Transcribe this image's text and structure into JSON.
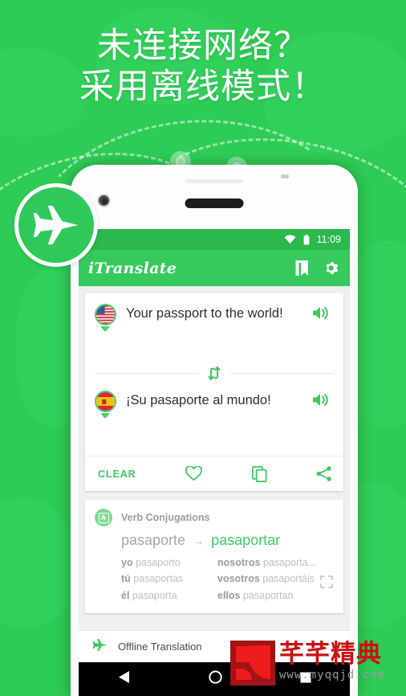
{
  "headline": {
    "line1": "未连接网络？",
    "line2": "采用离线模式！"
  },
  "badge": {
    "icon": "airplane-icon"
  },
  "phone": {
    "statusbar": {
      "wifi_icon": "wifi-icon",
      "battery_icon": "battery-icon",
      "time": "11:09"
    },
    "appbar": {
      "title": "iTranslate",
      "book_icon": "book-icon",
      "settings_icon": "gear-icon"
    },
    "translate": {
      "source": {
        "flag": "us-flag-icon",
        "text": "Your passport to the world!",
        "speaker_icon": "speaker-icon"
      },
      "swap_icon": "swap-vertical-icon",
      "target": {
        "flag": "spain-flag-icon",
        "text": "¡Su pasaporte al mundo!",
        "speaker_icon": "speaker-icon"
      },
      "actions": {
        "clear_label": "CLEAR",
        "favorite_icon": "heart-icon",
        "copy_icon": "copy-icon",
        "share_icon": "share-icon"
      }
    },
    "conjugations": {
      "badge_icon": "dictionary-icon",
      "title": "Verb Conjugations",
      "verb_from": "pasaporte",
      "arrow": "→",
      "verb_to": "pasaportar",
      "expand_icon": "expand-icon",
      "left_column": [
        {
          "pronoun": "yo",
          "form": "pasaporto"
        },
        {
          "pronoun": "tú",
          "form": "pasaportas"
        },
        {
          "pronoun": "él",
          "form": "pasaporta"
        }
      ],
      "right_column": [
        {
          "pronoun": "nosotros",
          "form": "pasaporta..."
        },
        {
          "pronoun": "vosotros",
          "form": "pasaportáis"
        },
        {
          "pronoun": "ellos",
          "form": "pasaportan"
        }
      ]
    },
    "offline": {
      "icon": "airplane-icon",
      "label": "Offline Translation"
    },
    "navbar": {
      "back_icon": "back-triangle-icon",
      "home_icon": "home-circle-icon",
      "recents_icon": "recents-square-icon"
    }
  },
  "watermark": {
    "title": "芊芊精典",
    "url": "www.myqqjd.com"
  },
  "colors": {
    "background_green": "#2ecc55",
    "appbar_green": "#36c95c",
    "statusbar_green": "#2bb84c",
    "accent_green": "#3cc95f",
    "watermark_red": "#cc1111"
  }
}
